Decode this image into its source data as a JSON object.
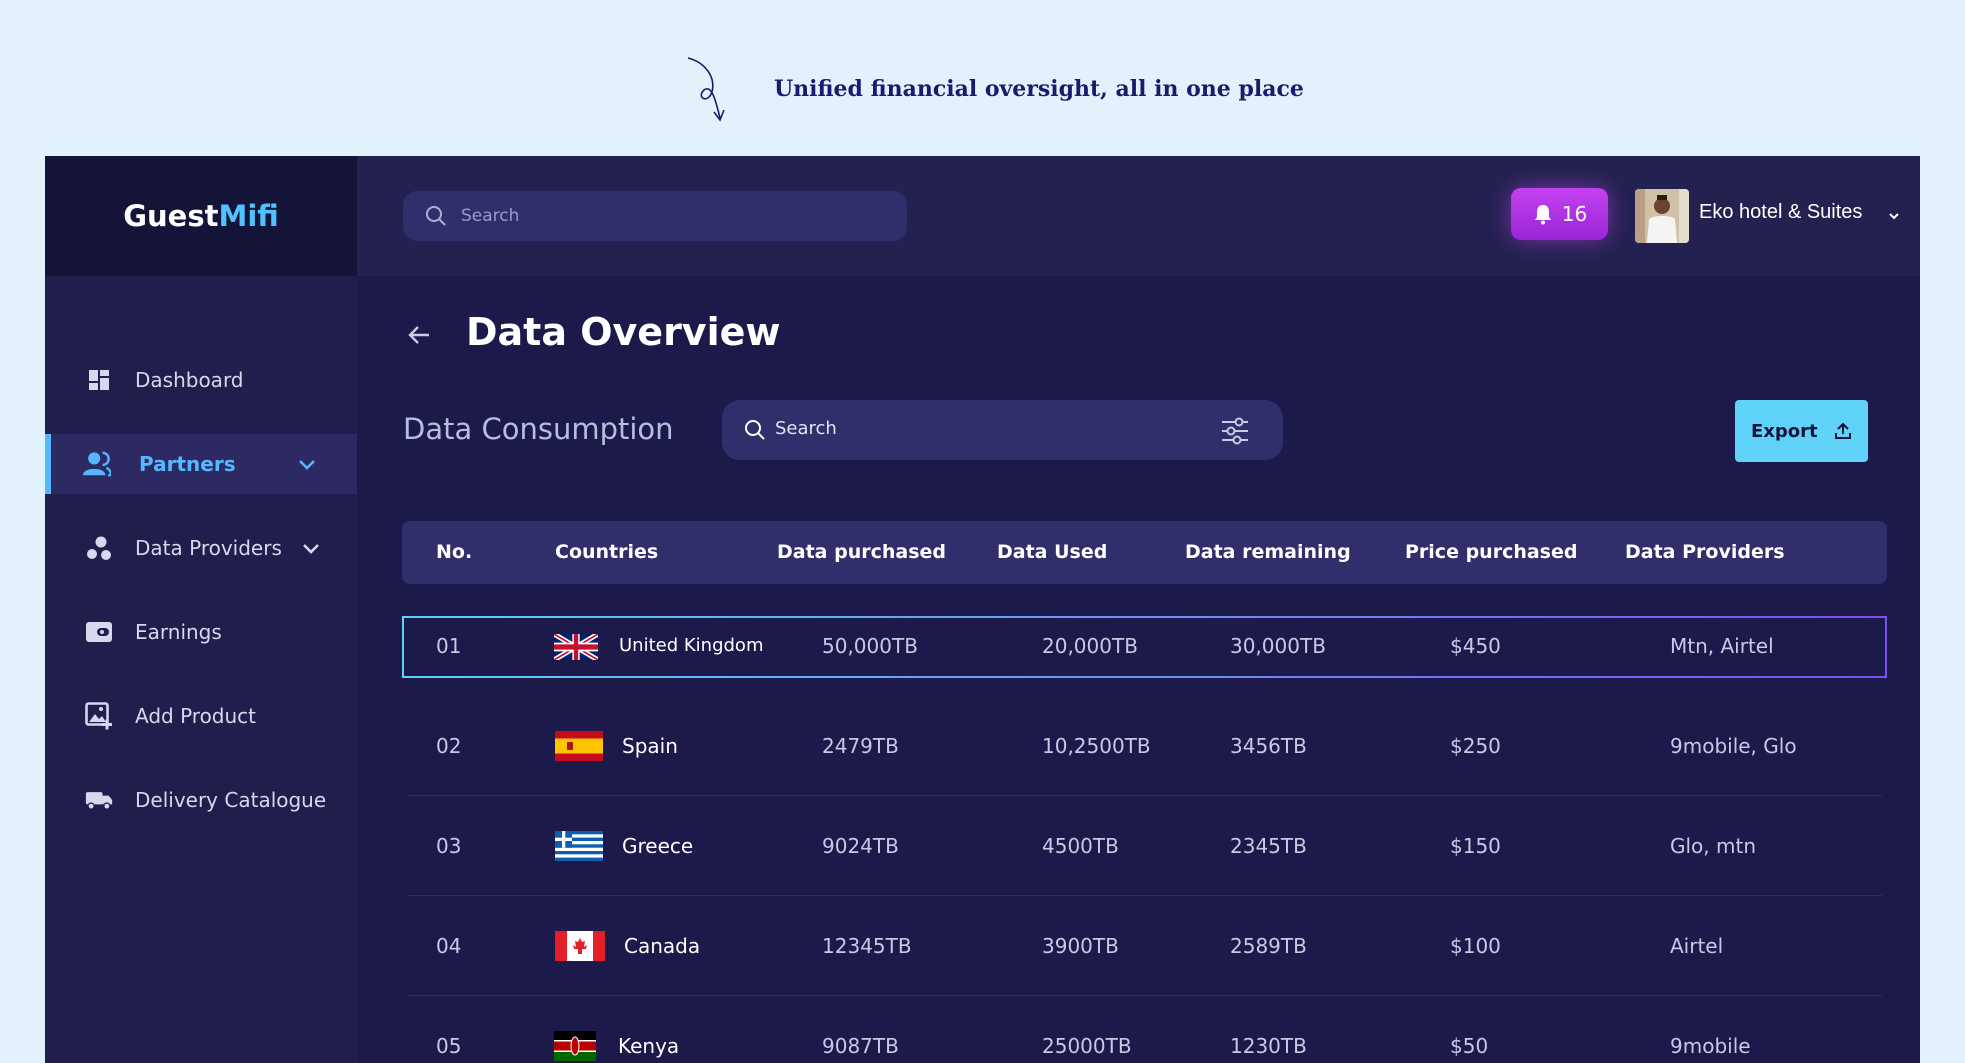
{
  "tagline": "Unified financial oversight, all in one place",
  "brand": {
    "part1": "Guest",
    "part2": "Mifi"
  },
  "sidebar": {
    "items": [
      {
        "label": "Dashboard",
        "icon": "dashboard-icon"
      },
      {
        "label": "Partners",
        "icon": "partners-icon",
        "active": true
      },
      {
        "label": "Data Providers",
        "icon": "data-providers-icon"
      },
      {
        "label": "Earnings",
        "icon": "wallet-icon"
      },
      {
        "label": "Add Product",
        "icon": "add-image-icon"
      },
      {
        "label": "Delivery Catalogue",
        "icon": "truck-icon"
      }
    ]
  },
  "topbar": {
    "search_placeholder": "Search",
    "notification_count": "16",
    "hotel_name": "Eko hotel & Suites"
  },
  "main": {
    "page_title": "Data Overview",
    "section_title": "Data Consumption",
    "search_placeholder": "Search",
    "export_label": "Export"
  },
  "table": {
    "headers": [
      "No.",
      "Countries",
      "Data purchased",
      "Data Used",
      "Data remaining",
      "Price purchased",
      "Data Providers"
    ],
    "rows": [
      {
        "no": "01",
        "country": "United Kingdom",
        "flag": "uk-flag-icon",
        "purchased": "50,000TB",
        "used": "20,000TB",
        "remaining": "30,000TB",
        "price": "$450",
        "providers": "Mtn, Airtel"
      },
      {
        "no": "02",
        "country": "Spain",
        "flag": "spain-flag-icon",
        "purchased": "2479TB",
        "used": "10,2500TB",
        "remaining": "3456TB",
        "price": "$250",
        "providers": "9mobile, Glo"
      },
      {
        "no": "03",
        "country": "Greece",
        "flag": "greece-flag-icon",
        "purchased": "9024TB",
        "used": "4500TB",
        "remaining": "2345TB",
        "price": "$150",
        "providers": "Glo, mtn"
      },
      {
        "no": "04",
        "country": "Canada",
        "flag": "canada-flag-icon",
        "purchased": "12345TB",
        "used": "3900TB",
        "remaining": "2589TB",
        "price": "$100",
        "providers": "Airtel"
      },
      {
        "no": "05",
        "country": "Kenya",
        "flag": "kenya-flag-icon",
        "purchased": "9087TB",
        "used": "25000TB",
        "remaining": "1230TB",
        "price": "$50",
        "providers": "9mobile"
      }
    ]
  },
  "colors": {
    "accent": "#55b7ff",
    "export_button": "#5fd2f7",
    "notification": "#b535e6",
    "background": "#1c1a4a"
  }
}
